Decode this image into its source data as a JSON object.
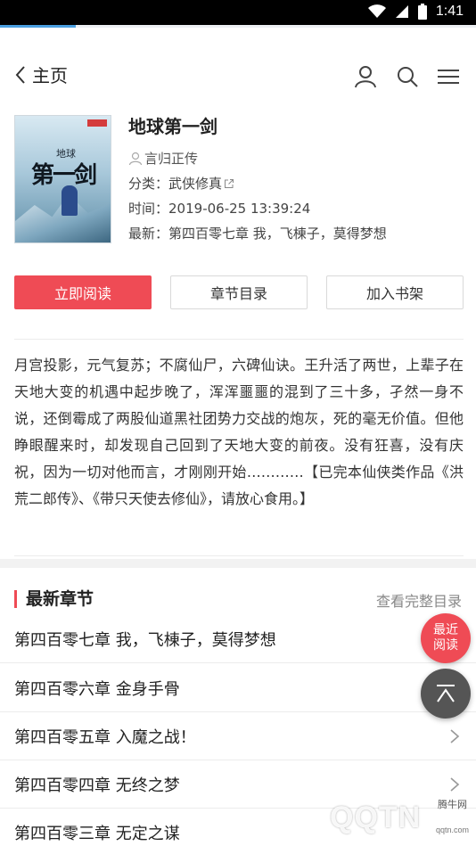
{
  "status_bar": {
    "time": "1:41",
    "reading_progress": 0.16
  },
  "header": {
    "back_label": "主页",
    "icons": [
      "user-icon",
      "search-icon",
      "menu-icon"
    ]
  },
  "book": {
    "title": "地球第一剑",
    "cover": {
      "small_title": "地球",
      "big_title": "第一剑"
    },
    "author": "言归正传",
    "category_label": "分类：",
    "category": "武侠修真",
    "time_label": "时间：",
    "time": "2019-06-25 13:39:24",
    "latest_label": "最新：",
    "latest": "第四百零七章 我，飞棟子，莫得梦想"
  },
  "actions": {
    "read": "立即阅读",
    "toc": "章节目录",
    "shelf": "加入书架"
  },
  "intro": "月宫投影，元气复苏；不腐仙尸，六碑仙诀。王升活了两世，上辈子在天地大变的机遇中起步晚了，浑浑噩噩的混到了三十多，孑然一身不说，还倒霉成了两股仙道黑社团势力交战的炮灰，死的毫无价值。但他睁眼醒来时，却发现自己回到了天地大变的前夜。没有狂喜，没有庆祝，因为一切对他而言，才刚刚开始…………【已完本仙侠类作品《洪荒二郎传》、《带只天使去修仙》，请放心食用。】",
  "chapters_section": {
    "heading": "最新章节",
    "view_all": "查看完整目录",
    "items": [
      "第四百零七章 我，飞棟子，莫得梦想",
      "第四百零六章 金身手骨",
      "第四百零五章 入魔之战！",
      "第四百零四章 无终之梦",
      "第四百零三章 无定之谋"
    ]
  },
  "fab": {
    "recent_line1": "最近",
    "recent_line2": "阅读"
  },
  "watermark": {
    "logo": "QQTN",
    "site_cn": "腾牛网",
    "site_url": "qqtn.com"
  },
  "colors": {
    "accent": "#ef4b55",
    "progress": "#4a9fe0"
  }
}
